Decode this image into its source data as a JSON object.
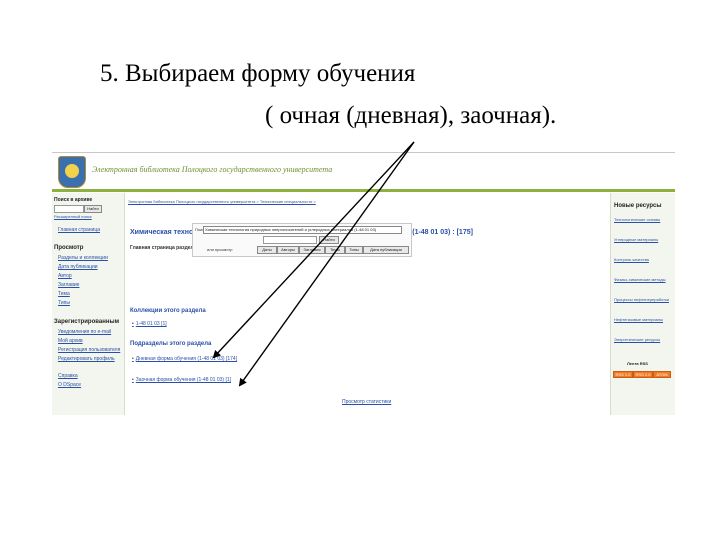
{
  "slide": {
    "title_line1": "5. Выбираем форму обучения",
    "title_line2": "( очная (дневная), заочная)."
  },
  "site": {
    "title": "Электронная библиотека Полоцкого государственного университета"
  },
  "left_sidebar": {
    "search_heading": "Поиск в архиве",
    "search_button": "Найти",
    "advanced_search": "Расширенный поиск",
    "home": "Главная страница",
    "browse_heading": "Просмотр",
    "browse_items": [
      "Разделы и коллекции",
      "Дата публикации",
      "Автор",
      "Заглавие",
      "Тема",
      "Типы"
    ],
    "registered_heading": "Зарегистрированным",
    "registered_items": [
      "Уведомления по e-mail",
      "Мой архив",
      "Регистрация пользователя",
      "Редактировать профиль"
    ],
    "help_items": [
      "Справка",
      "О DSpace"
    ]
  },
  "main": {
    "breadcrumb": "Электронная библиотека Полоцкого государственного университета > Технические специальности >",
    "heading": "Химическая технология природных энергоносителей и углеродных материалов (1-48 01 03) : [175]",
    "subheading": "Главная страница раздела",
    "search": {
      "label_search": "Поиск:",
      "scope_value": "Химическая технология природных энергоносителей и углеродных материалов (1-48 01 03)",
      "find_button": "Найти",
      "browse_label": "или просмотр",
      "browse_buttons": [
        "Даты",
        "Авторы",
        "Заглавия",
        "Темы",
        "Типы",
        "Дата публикации"
      ]
    },
    "collections_heading": "Коллекции этого раздела",
    "collection_item": "1-48 01 03 [1]",
    "subsections_heading": "Подразделы этого раздела",
    "subsection_items": [
      "Дневная форма обучения (1-48 01 03) [174]",
      "Заочная форма обучения (1-48 01 03) [1]"
    ],
    "footer_link": "Просмотр статистики"
  },
  "right_sidebar": {
    "heading": "Новые ресурсы",
    "items": [
      "Технологические основы",
      "Углеродные материалы",
      "Контроль качества",
      "Физико-химические методы",
      "Процессы нефтепереработки",
      "Нефтегазовые материалы",
      "Энергетические ресурсы"
    ],
    "rss_label": "Лента RSS",
    "rss_buttons": [
      "RSS 1.0",
      "RSS 2.0",
      "ATOM"
    ]
  },
  "colors": {
    "banner_stripe": "#8db13f",
    "link": "#2a4fa8"
  }
}
